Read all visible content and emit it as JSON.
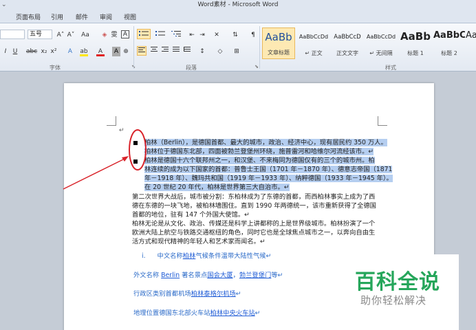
{
  "window": {
    "title": "Word素材 - Microsoft Word",
    "control": "⌄"
  },
  "tabs": [
    "页面布局",
    "引用",
    "邮件",
    "审阅",
    "视图"
  ],
  "ribbon": {
    "font": {
      "size": "五号",
      "grow": "A˄",
      "shrink": "A˅",
      "case": "Aa",
      "clear": "◈",
      "phonetic": "雯",
      "border": "A",
      "italic": "I",
      "underline": "U",
      "strike": "abc",
      "sub": "x₂",
      "sup": "x²",
      "effects": "A",
      "highlight": "ab",
      "color": "A",
      "shade": "A",
      "enclose": "⊕",
      "group_label": "字体"
    },
    "paragraph": {
      "group_label": "段落"
    },
    "styles": {
      "group_label": "样式",
      "items": [
        {
          "sample": "AaBb",
          "name": "文章标题"
        },
        {
          "sample": "AaBbCcDd",
          "name": "↵ 正文"
        },
        {
          "sample": "AaBbCcD",
          "name": "正文文字"
        },
        {
          "sample": "AaBbCcDd",
          "name": "↵ 无间隔"
        },
        {
          "sample": "AaBb",
          "name": "标题 1"
        },
        {
          "sample": "AaBbC",
          "name": "标题 2"
        },
        {
          "sample": "Aa",
          "name": ""
        }
      ]
    }
  },
  "document": {
    "return_mark": "↵",
    "selected_lines": [
      "柏林（Berlin），是德国首都、最大的城市，政治、经济中心，现有居民约 350 万人。",
      "柏林位于德国东北部，四面被勃兰登堡州环绕，施普雷河和哈维尔河流经该市。↵",
      "柏林是德国十六个联邦州之一，和汉堡、不来梅同为德国仅有的三个的城市州。柏",
      "林连续的成为以下国家的首都：普鲁士王国（1701 年－1870 年）、德意志帝国（1871",
      "年－1918 年）、魏玛共和国（1919 年－1933 年）、纳粹德国（1933 年－1945 年）。",
      "在 20 世纪 20 年代，柏林是世界第三大自治市。↵"
    ],
    "body_lines": [
      "第二次世界大战后，城市被分割：东柏林成为了东德的首都，而西柏林事实上成为了西",
      "德在东德的一块飞地，被柏林墙围住。直到 1990 年两德统一，该市重新获得了全德国",
      "首都的地位，驻有 147 个外国大使馆。↵",
      "柏林无论是从文化、政治、传媒还是科学上讲都称的上是世界级城市。柏林扮演了一个",
      "欧洲大陆上航空与铁路交通枢纽的角色，同时它也是全球焦点城市之一，以奔向自由生",
      "活方式和现代精神的年轻人和艺术家而闻名。↵"
    ],
    "list_item": {
      "marker": "i.",
      "prefix": "中文名称",
      "link": "柏林",
      "suffix": "气候条件温带大陆性气候↵"
    },
    "foreign_name": {
      "prefix": "外文名称 ",
      "link1": "Berlin",
      "mid": " 著名景点",
      "link2": "国会大厦",
      "sep": "，",
      "link3": "勃兰登堡门",
      "suffix": "等↵"
    },
    "admin": {
      "prefix": "行政区类别首都机场",
      "link": "柏林泰格尔机场",
      "suffix": "↵"
    },
    "geo": {
      "prefix": "地理位置德国东北部火车站",
      "link": "柏林中央火车站",
      "suffix": "↵"
    }
  },
  "watermark": {
    "title": "百科全说",
    "subtitle": "助你轻松解决"
  },
  "colors": {
    "annotation": "#d9232a",
    "highlight": "#b5cef0",
    "link": "#1e5bd6",
    "watermark": "#26a65b"
  }
}
